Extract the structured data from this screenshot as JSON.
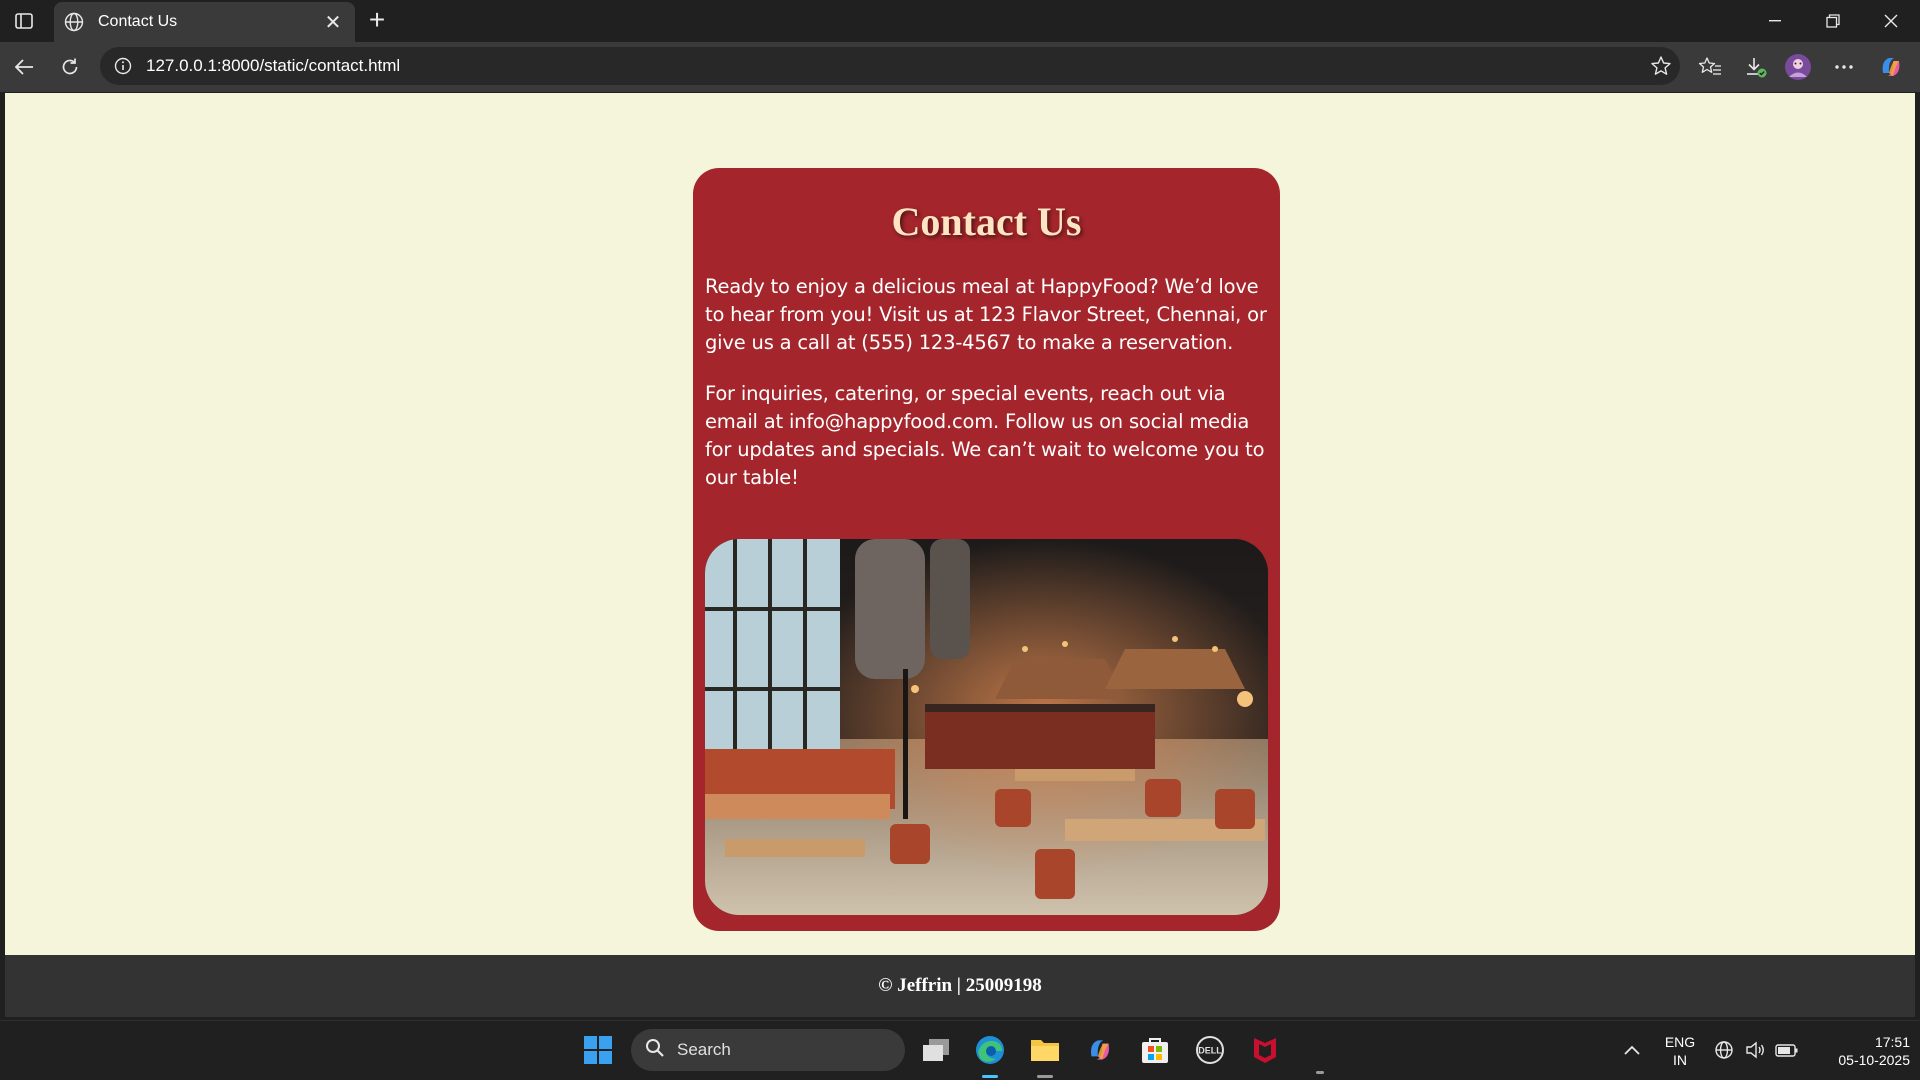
{
  "browser": {
    "tab_title": "Contact Us",
    "url": "127.0.0.1:8000/static/contact.html"
  },
  "page": {
    "heading": "Contact Us",
    "paragraphs": [
      "Ready to enjoy a delicious meal at HappyFood? We’d love to hear from you! Visit us at 123 Flavor Street, Chennai, or give us a call at (555) 123-4567 to make a reservation.",
      "For inquiries, catering, or special events, reach out via email at info@happyfood.com. Follow us on social media for updates and specials. We can’t wait to welcome you to our table!"
    ],
    "footer_text": "© Jeffrin | 25009198",
    "colors": {
      "background": "#f5f5dc",
      "card": "#a4262c",
      "heading": "#ffe4c4",
      "footer": "#333333"
    }
  },
  "taskbar": {
    "search_label": "Search",
    "language": "ENG",
    "region": "IN",
    "time": "17:51",
    "date": "05-10-2025"
  }
}
